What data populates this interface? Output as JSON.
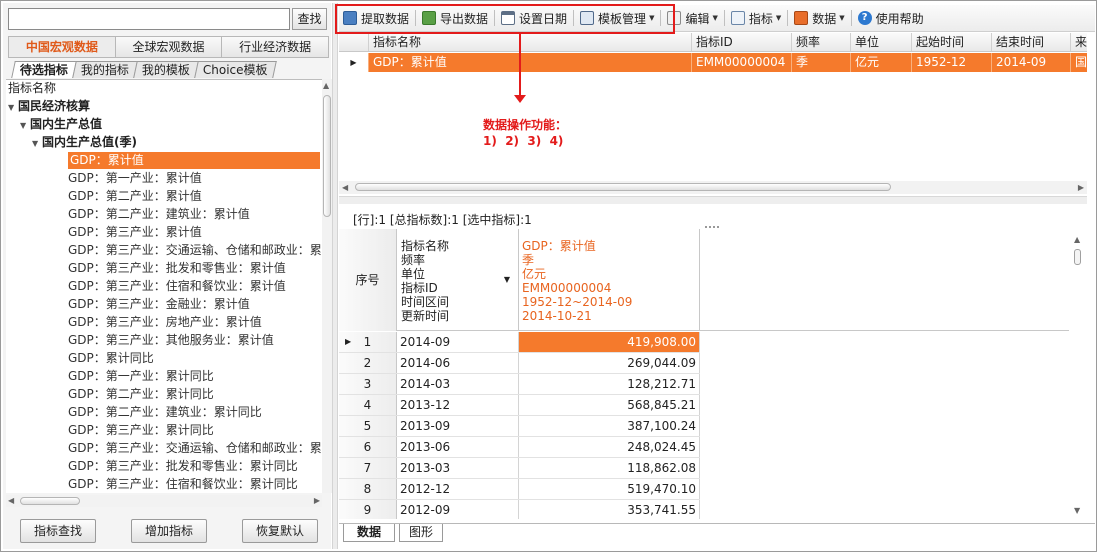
{
  "search": {
    "placeholder": "",
    "button": "查找"
  },
  "category_tabs": [
    "中国宏观数据",
    "全球宏观数据",
    "行业经济数据"
  ],
  "sub_tabs": [
    "待选指标",
    "我的指标",
    "我的模板",
    "Choice模板"
  ],
  "tree": {
    "header": "指标名称",
    "nodes": [
      "国民经济核算",
      "国内生产总值",
      "国内生产总值(季)"
    ],
    "leaves": [
      "GDP：累计值",
      "GDP：第一产业：累计值",
      "GDP：第二产业：累计值",
      "GDP：第二产业：建筑业：累计值",
      "GDP：第三产业：累计值",
      "GDP：第三产业：交通运输、仓储和邮政业：累",
      "GDP：第三产业：批发和零售业：累计值",
      "GDP：第三产业：住宿和餐饮业：累计值",
      "GDP：第三产业：金融业：累计值",
      "GDP：第三产业：房地产业：累计值",
      "GDP：第三产业：其他服务业：累计值",
      "GDP：累计同比",
      "GDP：第一产业：累计同比",
      "GDP：第二产业：累计同比",
      "GDP：第二产业：建筑业：累计同比",
      "GDP：第三产业：累计同比",
      "GDP：第三产业：交通运输、仓储和邮政业：累",
      "GDP：第三产业：批发和零售业：累计同比",
      "GDP：第三产业：住宿和餐饮业：累计同比"
    ]
  },
  "left_buttons": [
    "指标查找",
    "增加指标",
    "恢复默认"
  ],
  "toolbar": {
    "extract": "提取数据",
    "export": "导出数据",
    "set_date": "设置日期",
    "template": "模板管理",
    "edit": "编辑",
    "indicator": "指标",
    "data": "数据",
    "help": "使用帮助"
  },
  "annotation": {
    "title": "数据操作功能：",
    "items": "1)  2)  3)  4)"
  },
  "top_grid": {
    "headers": [
      "指标名称",
      "指标ID",
      "频率",
      "单位",
      "起始时间",
      "结束时间",
      "来"
    ],
    "row": [
      "GDP：累计值",
      "EMM00000004",
      "季",
      "亿元",
      "1952-12",
      "2014-09",
      "国"
    ]
  },
  "status": "[行]:1  [总指标数]:1  [选中指标]:1",
  "bottom_grid": {
    "rownum_header": "序号",
    "meta_labels": [
      "指标名称",
      "频率",
      "单位",
      "指标ID",
      "时间区间",
      "更新时间"
    ],
    "meta_values": [
      "GDP：累计值",
      "季",
      "亿元",
      "EMM00000004",
      "1952-12~2014-09",
      "2014-10-21"
    ],
    "rows": [
      {
        "n": "1",
        "date": "2014-09",
        "value": "419,908.00"
      },
      {
        "n": "2",
        "date": "2014-06",
        "value": "269,044.09"
      },
      {
        "n": "3",
        "date": "2014-03",
        "value": "128,212.71"
      },
      {
        "n": "4",
        "date": "2013-12",
        "value": "568,845.21"
      },
      {
        "n": "5",
        "date": "2013-09",
        "value": "387,100.24"
      },
      {
        "n": "6",
        "date": "2013-06",
        "value": "248,024.45"
      },
      {
        "n": "7",
        "date": "2013-03",
        "value": "118,862.08"
      },
      {
        "n": "8",
        "date": "2012-12",
        "value": "519,470.10"
      },
      {
        "n": "9",
        "date": "2012-09",
        "value": "353,741.55"
      }
    ]
  },
  "bottom_tabs": [
    "数据",
    "图形"
  ],
  "colors": {
    "accent": "#f57a2c",
    "highlight_red": "#e31b1b"
  }
}
